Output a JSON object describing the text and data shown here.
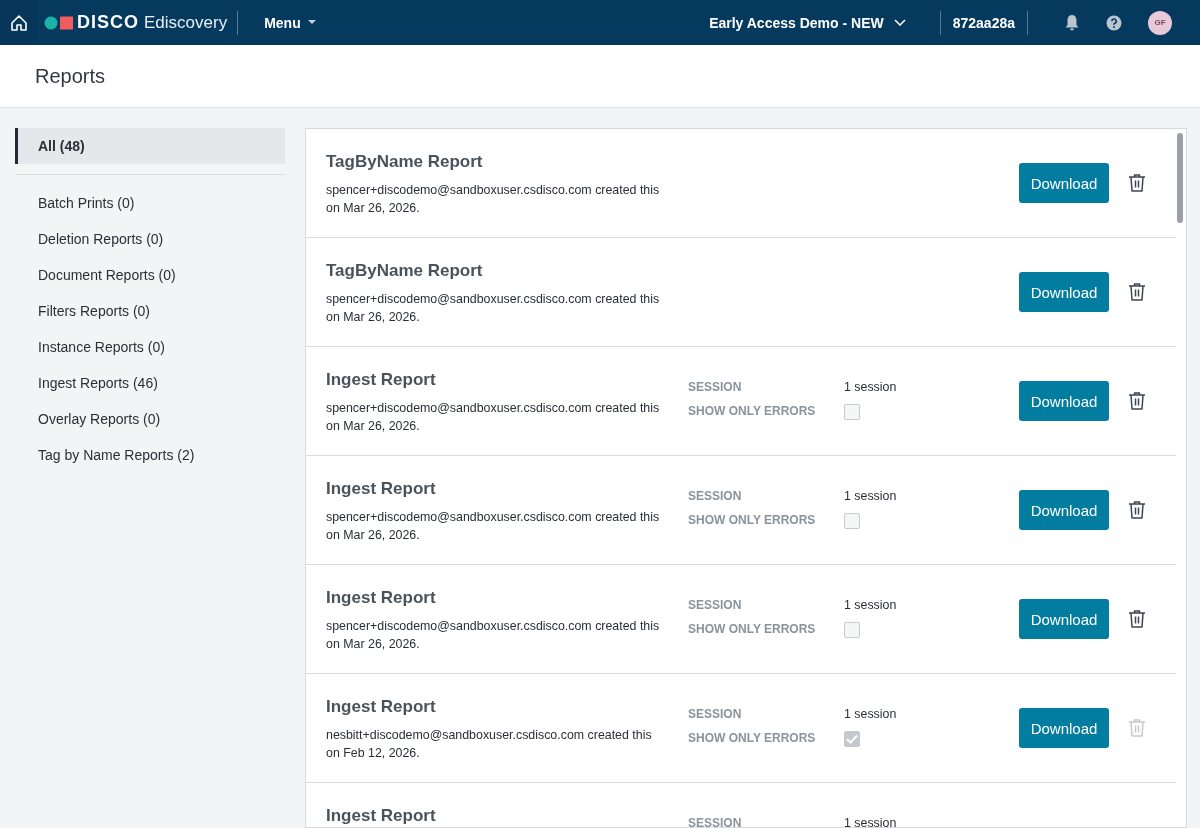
{
  "header": {
    "brand": "DISCO",
    "product": "Ediscovery",
    "menu": "Menu",
    "workspace": "Early Access Demo - NEW",
    "instance": "872aa28a",
    "avatar": "GF"
  },
  "page_title": "Reports",
  "sidebar": {
    "items": [
      {
        "label": "All (48)",
        "selected": true,
        "kind": "all"
      },
      {
        "label": "Batch Prints (0)",
        "selected": false,
        "kind": "type"
      },
      {
        "label": "Deletion Reports (0)",
        "selected": false,
        "kind": "type"
      },
      {
        "label": "Document Reports (0)",
        "selected": false,
        "kind": "type"
      },
      {
        "label": "Filters Reports (0)",
        "selected": false,
        "kind": "type"
      },
      {
        "label": "Instance Reports (0)",
        "selected": false,
        "kind": "type"
      },
      {
        "label": "Ingest Reports (46)",
        "selected": false,
        "kind": "type"
      },
      {
        "label": "Overlay Reports (0)",
        "selected": false,
        "kind": "type"
      },
      {
        "label": "Tag by Name Reports (2)",
        "selected": false,
        "kind": "type"
      }
    ]
  },
  "reports": [
    {
      "kind": "tag",
      "title": "TagByName Report",
      "creator": "spencer+discodemo@sandboxuser.csdisco.com created this",
      "date": "on Mar 26, 2026.",
      "button": "Download",
      "delete_disabled": false
    },
    {
      "kind": "tag",
      "title": "TagByName Report",
      "creator": "spencer+discodemo@sandboxuser.csdisco.com created this",
      "date": "on Mar 26, 2026.",
      "button": "Download",
      "delete_disabled": false
    },
    {
      "kind": "ingest",
      "title": "Ingest Report",
      "creator": "spencer+discodemo@sandboxuser.csdisco.com created this",
      "date": "on Mar 26, 2026.",
      "session_label": "SESSION",
      "session": "1 session",
      "errors_label": "SHOW ONLY ERRORS",
      "checked": false,
      "button": "Download",
      "delete_disabled": false
    },
    {
      "kind": "ingest",
      "title": "Ingest Report",
      "creator": "spencer+discodemo@sandboxuser.csdisco.com created this",
      "date": "on Mar 26, 2026.",
      "session_label": "SESSION",
      "session": "1 session",
      "errors_label": "SHOW ONLY ERRORS",
      "checked": false,
      "button": "Download",
      "delete_disabled": false
    },
    {
      "kind": "ingest",
      "title": "Ingest Report",
      "creator": "spencer+discodemo@sandboxuser.csdisco.com created this",
      "date": "on Mar 26, 2026.",
      "session_label": "SESSION",
      "session": "1 session",
      "errors_label": "SHOW ONLY ERRORS",
      "checked": false,
      "button": "Download",
      "delete_disabled": false
    },
    {
      "kind": "ingest",
      "title": "Ingest Report",
      "creator": "nesbitt+discodemo@sandboxuser.csdisco.com created this",
      "date": "on Feb 12, 2026.",
      "session_label": "SESSION",
      "session": "1 session",
      "errors_label": "SHOW ONLY ERRORS",
      "checked": true,
      "button": "Download",
      "delete_disabled": true
    },
    {
      "kind": "ingest_partial",
      "title": "Ingest Report",
      "session_label": "SESSION",
      "session": "1 session"
    }
  ]
}
